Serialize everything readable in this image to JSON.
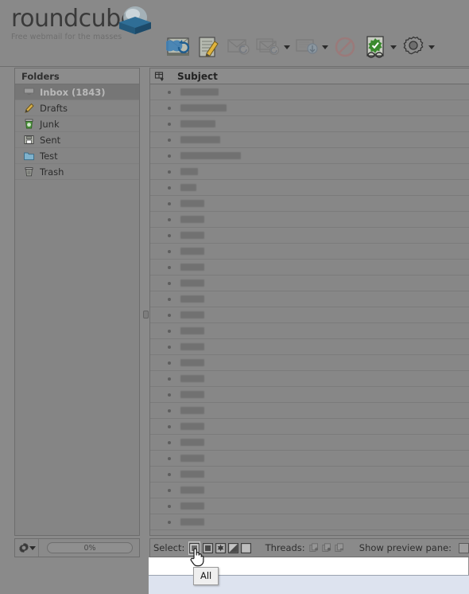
{
  "brand": {
    "name": "roundcube",
    "tagline": "Free webmail for the masses",
    "logo_icon": "roundcube-cube-logo"
  },
  "toolbar": {
    "buttons": [
      {
        "label": "Check mail",
        "icon": "check-mail-icon",
        "enabled": true,
        "has_arrow": false
      },
      {
        "label": "Compose",
        "icon": "compose-icon",
        "enabled": true,
        "has_arrow": false
      },
      {
        "label": "Reply",
        "icon": "reply-icon",
        "enabled": false,
        "has_arrow": false
      },
      {
        "label": "Reply to all",
        "icon": "reply-all-icon",
        "enabled": false,
        "has_arrow": true
      },
      {
        "label": "Forward",
        "icon": "forward-icon",
        "enabled": false,
        "has_arrow": true
      },
      {
        "label": "Delete",
        "icon": "delete-icon",
        "enabled": false,
        "has_arrow": false
      },
      {
        "label": "Mark",
        "icon": "mark-message-icon",
        "enabled": true,
        "has_arrow": true
      },
      {
        "label": "More",
        "icon": "gear-more-icon",
        "enabled": true,
        "has_arrow": true
      }
    ]
  },
  "sidebar": {
    "header": "Folders",
    "items": [
      {
        "label": "Inbox (1843)",
        "icon": "inbox-icon",
        "selected": true
      },
      {
        "label": "Drafts",
        "icon": "drafts-pencil-icon",
        "selected": false
      },
      {
        "label": "Junk",
        "icon": "junk-bin-icon",
        "selected": false
      },
      {
        "label": "Sent",
        "icon": "sent-icon",
        "selected": false
      },
      {
        "label": "Test",
        "icon": "folder-icon",
        "selected": false
      },
      {
        "label": "Trash",
        "icon": "trash-icon",
        "selected": false
      }
    ],
    "footer": {
      "settings_icon": "gear-icon",
      "settings_arrow_icon": "chevron-down-icon",
      "quota_label": "0%"
    }
  },
  "message_list": {
    "column_options_icon": "column-options-icon",
    "columns": [
      "Subject"
    ],
    "rows": [
      {
        "icon": "message-status-dot",
        "subject_width": 48
      },
      {
        "icon": "message-status-dot",
        "subject_width": 58
      },
      {
        "icon": "message-status-dot",
        "subject_width": 44
      },
      {
        "icon": "message-status-dot",
        "subject_width": 50
      },
      {
        "icon": "message-status-dot",
        "subject_width": 76
      },
      {
        "icon": "message-status-dot",
        "subject_width": 22
      },
      {
        "icon": "message-status-dot",
        "subject_width": 20
      },
      {
        "icon": "message-status-dot",
        "subject_width": 30
      },
      {
        "icon": "message-status-dot",
        "subject_width": 30
      },
      {
        "icon": "message-status-dot",
        "subject_width": 30
      },
      {
        "icon": "message-status-dot",
        "subject_width": 30
      },
      {
        "icon": "message-status-dot",
        "subject_width": 30
      },
      {
        "icon": "message-status-dot",
        "subject_width": 30
      },
      {
        "icon": "message-status-dot",
        "subject_width": 30
      },
      {
        "icon": "message-status-dot",
        "subject_width": 30
      },
      {
        "icon": "message-status-dot",
        "subject_width": 30
      },
      {
        "icon": "message-status-dot",
        "subject_width": 30
      },
      {
        "icon": "message-status-dot",
        "subject_width": 30
      },
      {
        "icon": "message-status-dot",
        "subject_width": 30
      },
      {
        "icon": "message-status-dot",
        "subject_width": 30
      },
      {
        "icon": "message-status-dot",
        "subject_width": 30
      },
      {
        "icon": "message-status-dot",
        "subject_width": 30
      },
      {
        "icon": "message-status-dot",
        "subject_width": 30
      },
      {
        "icon": "message-status-dot",
        "subject_width": 30
      },
      {
        "icon": "message-status-dot",
        "subject_width": 30
      },
      {
        "icon": "message-status-dot",
        "subject_width": 30
      },
      {
        "icon": "message-status-dot",
        "subject_width": 30
      },
      {
        "icon": "message-status-dot",
        "subject_width": 30
      }
    ]
  },
  "list_footer": {
    "select_label": "Select:",
    "select_buttons": [
      {
        "label": "All",
        "icon": "select-all-icon",
        "hovered": true
      },
      {
        "label": "Current page",
        "icon": "select-page-icon",
        "hovered": false
      },
      {
        "label": "Unread",
        "icon": "select-unread-icon",
        "hovered": false
      },
      {
        "label": "Invert",
        "icon": "select-invert-icon",
        "hovered": false
      },
      {
        "label": "None",
        "icon": "select-none-icon",
        "hovered": false
      }
    ],
    "threads_label": "Threads:",
    "thread_buttons": [
      {
        "label": "Expand all",
        "icon": "threads-expand-all-icon"
      },
      {
        "label": "Expand unread",
        "icon": "threads-expand-unread-icon"
      },
      {
        "label": "Collapse all",
        "icon": "threads-collapse-all-icon"
      }
    ],
    "preview_label": "Show preview pane:",
    "preview_checked": false
  },
  "tooltip": {
    "text": "All"
  },
  "cursor": {
    "icon": "pointing-hand-cursor"
  },
  "colors": {
    "overlay_gray": "#8a8a8a",
    "panel_gray": "#878787",
    "selected_row": "#767676",
    "tooltip_bg": "#efefef",
    "dropdown_bg": "#ffffff",
    "dropdown_lower": "#dde3ef"
  }
}
